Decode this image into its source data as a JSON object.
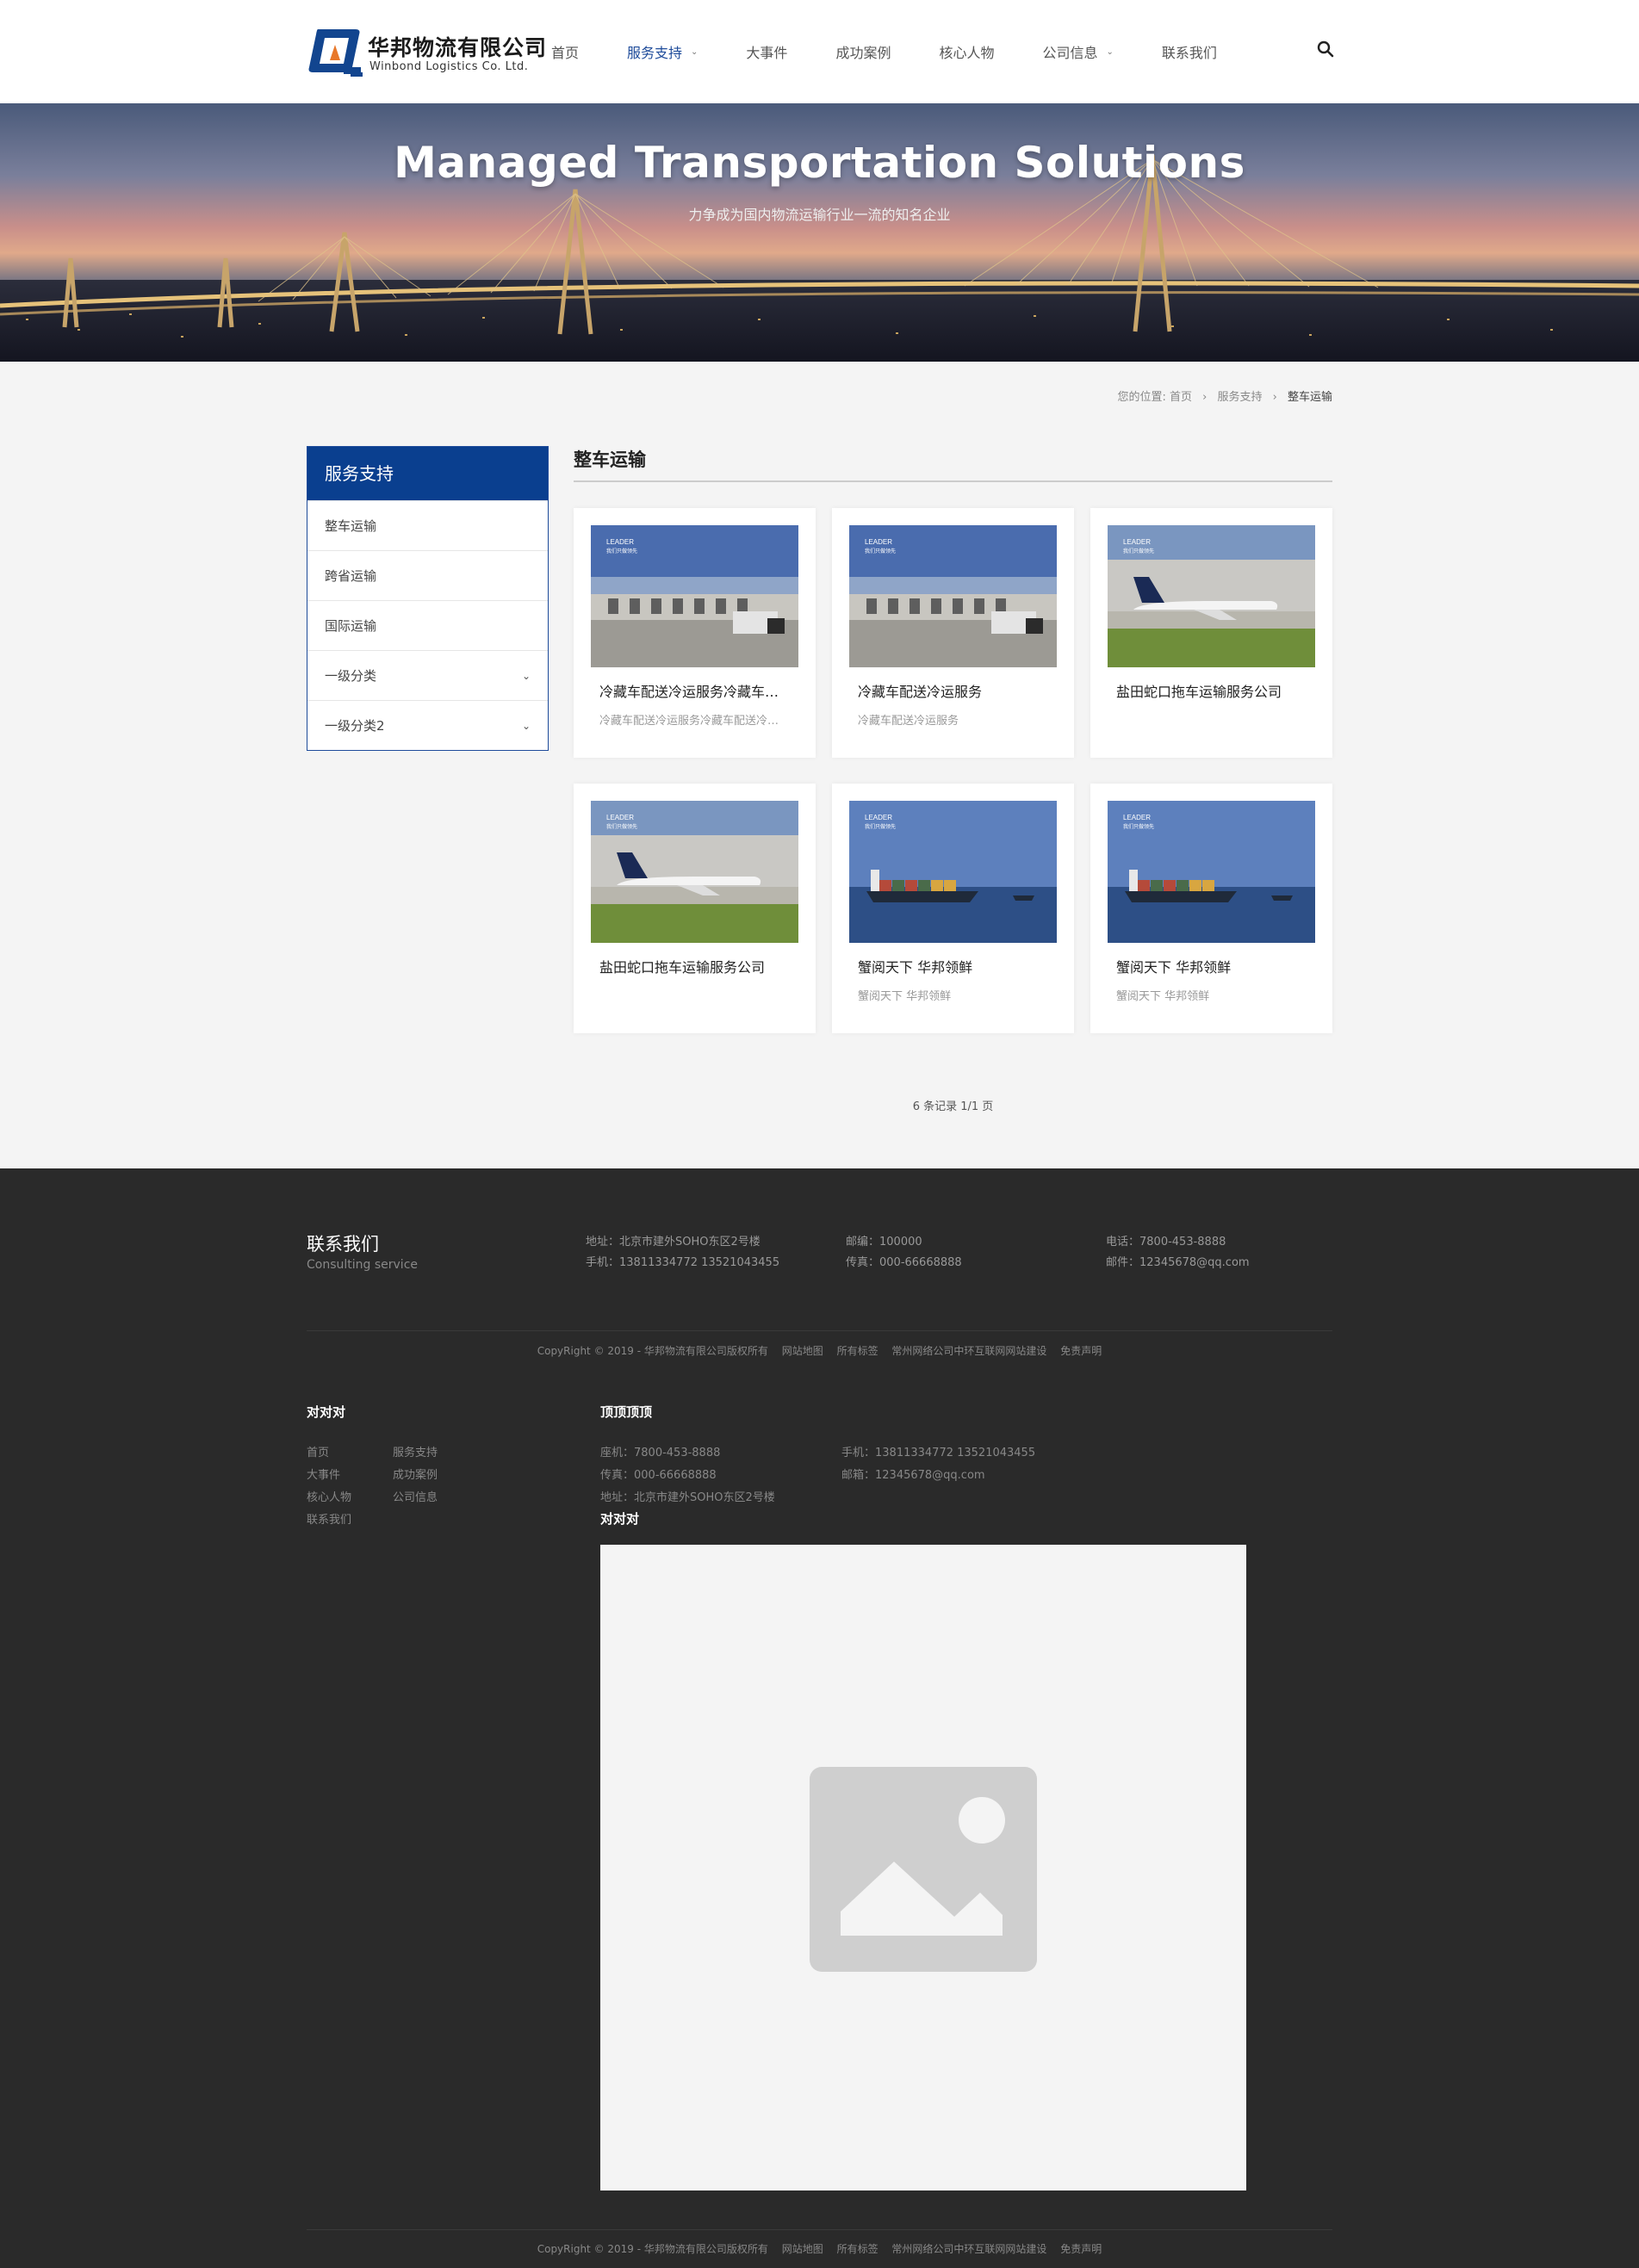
{
  "header": {
    "logo_cn": "华邦物流有限公司",
    "logo_en": "Winbond Logistics Co. Ltd.",
    "nav": [
      {
        "label": "首页",
        "active": false,
        "dropdown": false
      },
      {
        "label": "服务支持",
        "active": true,
        "dropdown": true
      },
      {
        "label": "大事件",
        "active": false,
        "dropdown": false
      },
      {
        "label": "成功案例",
        "active": false,
        "dropdown": false
      },
      {
        "label": "核心人物",
        "active": false,
        "dropdown": false
      },
      {
        "label": "公司信息",
        "active": false,
        "dropdown": true
      },
      {
        "label": "联系我们",
        "active": false,
        "dropdown": false
      }
    ]
  },
  "banner": {
    "title": "Managed Transportation Solutions",
    "subtitle": "力争成为国内物流运输行业一流的知名企业"
  },
  "breadcrumb": {
    "prefix": "您的位置:",
    "items": [
      "首页",
      "服务支持",
      "整车运输"
    ]
  },
  "sidebar": {
    "title": "服务支持",
    "items": [
      {
        "label": "整车运输",
        "expandable": false
      },
      {
        "label": "跨省运输",
        "expandable": false
      },
      {
        "label": "国际运输",
        "expandable": false
      },
      {
        "label": "一级分类",
        "expandable": true
      },
      {
        "label": "一级分类2",
        "expandable": true
      }
    ]
  },
  "main": {
    "title": "整车运输",
    "cards": [
      {
        "title": "冷藏车配送冷运服务冷藏车配送冷运服务",
        "desc": "冷藏车配送冷运服务冷藏车配送冷运服务",
        "image": "truck"
      },
      {
        "title": "冷藏车配送冷运服务",
        "desc": "冷藏车配送冷运服务",
        "image": "truck"
      },
      {
        "title": "盐田蛇口拖车运输服务公司",
        "desc": "",
        "image": "plane"
      },
      {
        "title": "盐田蛇口拖车运输服务公司",
        "desc": "",
        "image": "plane"
      },
      {
        "title": "蟹阅天下 华邦领鲜",
        "desc": "蟹阅天下 华邦领鲜",
        "image": "ship"
      },
      {
        "title": "蟹阅天下 华邦领鲜",
        "desc": "蟹阅天下 华邦领鲜",
        "image": "ship"
      }
    ],
    "card_image_label": "LEADER",
    "card_image_sublabel": "我们只做领先",
    "pager": "6 条记录 1/1 页"
  },
  "footer": {
    "contact_title": "联系我们",
    "contact_sub": "Consulting service",
    "info": {
      "address": "地址：北京市建外SOHO东区2号楼",
      "mobile": "手机：13811334772  13521043455",
      "zip": "邮编：100000",
      "fax": "传真：000-66668888",
      "phone": "电话：7800-453-8888",
      "email": "邮件：12345678@qq.com"
    },
    "copyright": {
      "text": "CopyRight © 2019 -  华邦物流有限公司版权所有",
      "links": [
        "网站地图",
        "所有标签",
        "常州网络公司中环互联网网站建设",
        "免责声明"
      ]
    },
    "col1_title": "对对对",
    "col1_links": [
      "首页",
      "服务支持",
      "大事件",
      "成功案例",
      "核心人物",
      "公司信息",
      "联系我们"
    ],
    "col2_title": "顶顶顶顶",
    "col2_info": {
      "landline": "座机：7800-453-8888",
      "mobile": "手机：13811334772  13521043455",
      "fax": "传真：000-66668888",
      "email": "邮箱：12345678@qq.com",
      "address": "地址：北京市建外SOHO东区2号楼"
    },
    "col3_title": "对对对"
  }
}
